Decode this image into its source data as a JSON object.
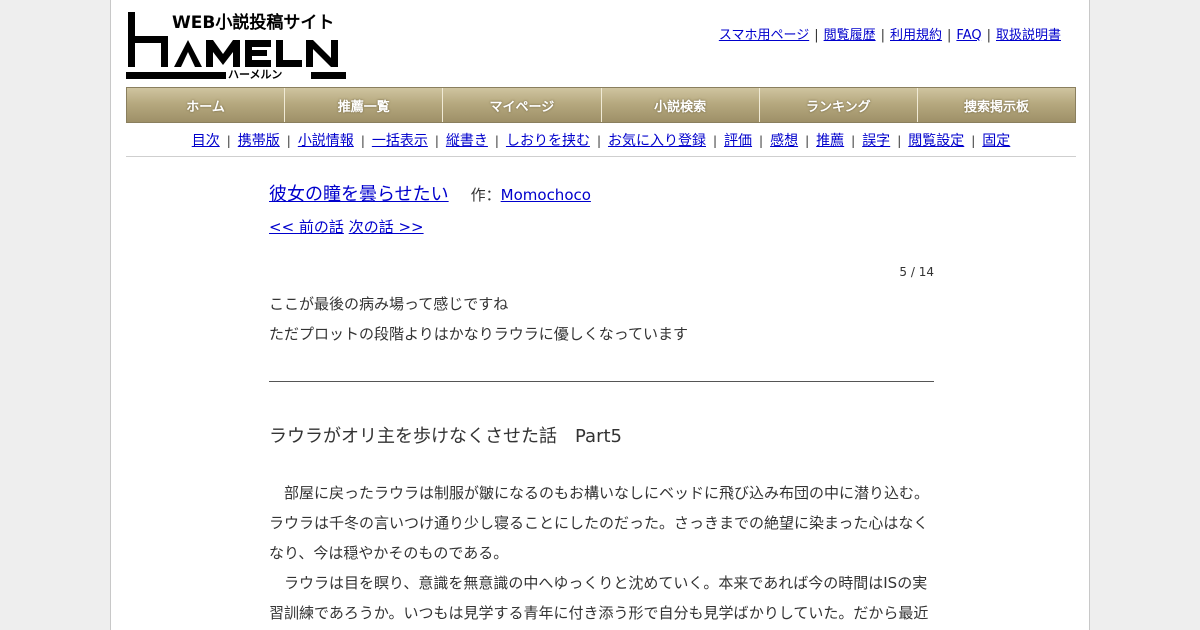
{
  "logo": {
    "tagline": "WEB小説投稿サイト",
    "name": "HAMELN",
    "kana": "ハーメルン"
  },
  "top_links": [
    "スマホ用ページ",
    "閲覧履歴",
    "利用規約",
    "FAQ",
    "取扱説明書"
  ],
  "nav": [
    "ホーム",
    "推薦一覧",
    "マイページ",
    "小説検索",
    "ランキング",
    "捜索掲示板"
  ],
  "subnav": [
    "目次",
    "携帯版",
    "小説情報",
    "一括表示",
    "縦書き",
    "しおりを挟む",
    "お気に入り登録",
    "評価",
    "感想",
    "推薦",
    "誤字",
    "閲覧設定",
    "固定"
  ],
  "novel": {
    "title": "彼女の瞳を曇らせたい",
    "author_prefix": "作：",
    "author": "Momochoco",
    "prev": "<< 前の話",
    "next": "次の話 >>",
    "counter": "5 / 14"
  },
  "preface": [
    "ここが最後の病み場って感じですね",
    "ただプロットの段階よりはかなりラウラに優しくなっています"
  ],
  "chapter_title": "ラウラがオリ主を歩けなくさせた話　Part5",
  "body": [
    "　部屋に戻ったラウラは制服が皺になるのもお構いなしにベッドに飛び込み布団の中に潜り込む。ラウラは千冬の言いつけ通り少し寝ることにしたのだった。さっきまでの絶望に染まった心はなくなり、今は穏やかそのものである。",
    "　ラウラは目を瞑り、意識を無意識の中へゆっくりと沈めていく。本来であれば今の時間はISの実習訓練であろうか。いつもは見学する青年に付き添う形で自分も見学ばかりしていた。だから最近"
  ]
}
